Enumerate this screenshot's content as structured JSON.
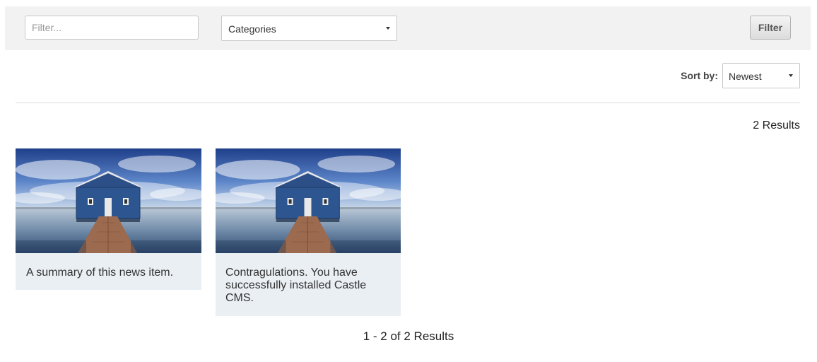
{
  "filter_bar": {
    "search_placeholder": "Filter...",
    "categories_selected": "Categories",
    "filter_button_label": "Filter"
  },
  "sort": {
    "label": "Sort by:",
    "selected": "Newest"
  },
  "results": {
    "count_text": "2 Results",
    "items": [
      {
        "summary": "A summary of this news item."
      },
      {
        "summary": "Contragulations. You have successfully installed Castle CMS."
      }
    ]
  },
  "pagination": {
    "text": "1 - 2 of 2 Results"
  }
}
